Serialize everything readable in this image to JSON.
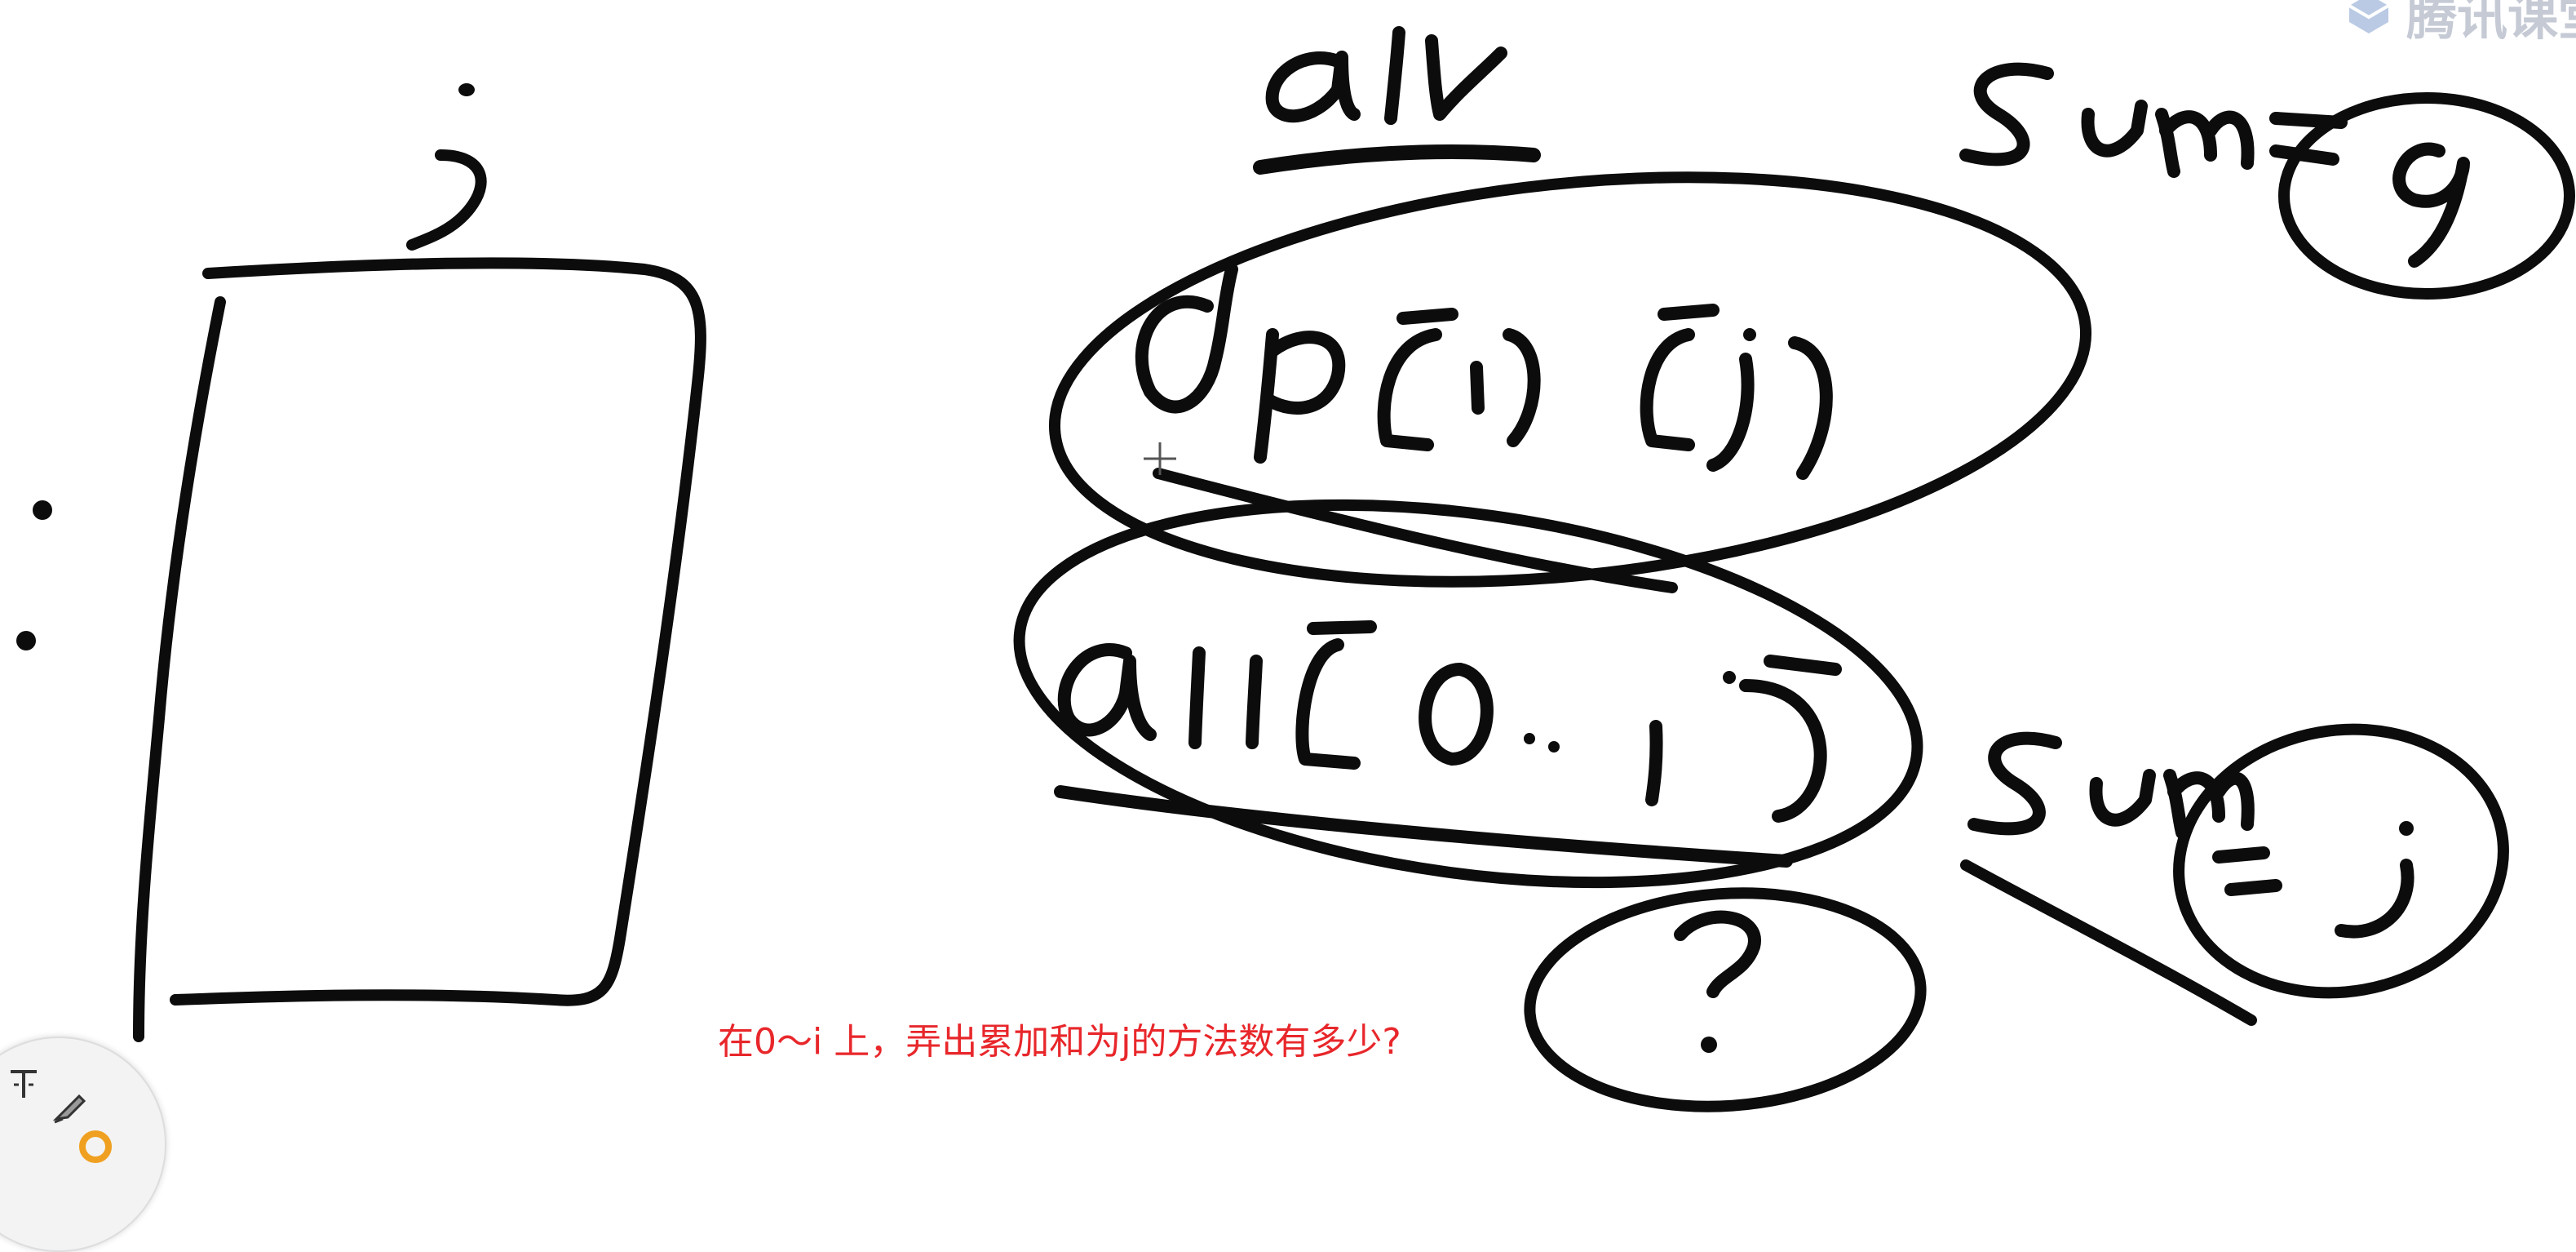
{
  "caption": "在0～i 上，弄出累加和为j的方法数有多少?",
  "colors": {
    "ink": "#0c0c0c",
    "caption": "#e8272b",
    "background": "#ffffff"
  },
  "watermark": {
    "brand": "腾讯课堂",
    "icon": "tencent-classroom-logo-icon"
  },
  "toolbar": {
    "tools": [
      {
        "name": "text-tool-icon"
      },
      {
        "name": "pen-tool-icon"
      },
      {
        "name": "color-picker-icon"
      }
    ]
  }
}
